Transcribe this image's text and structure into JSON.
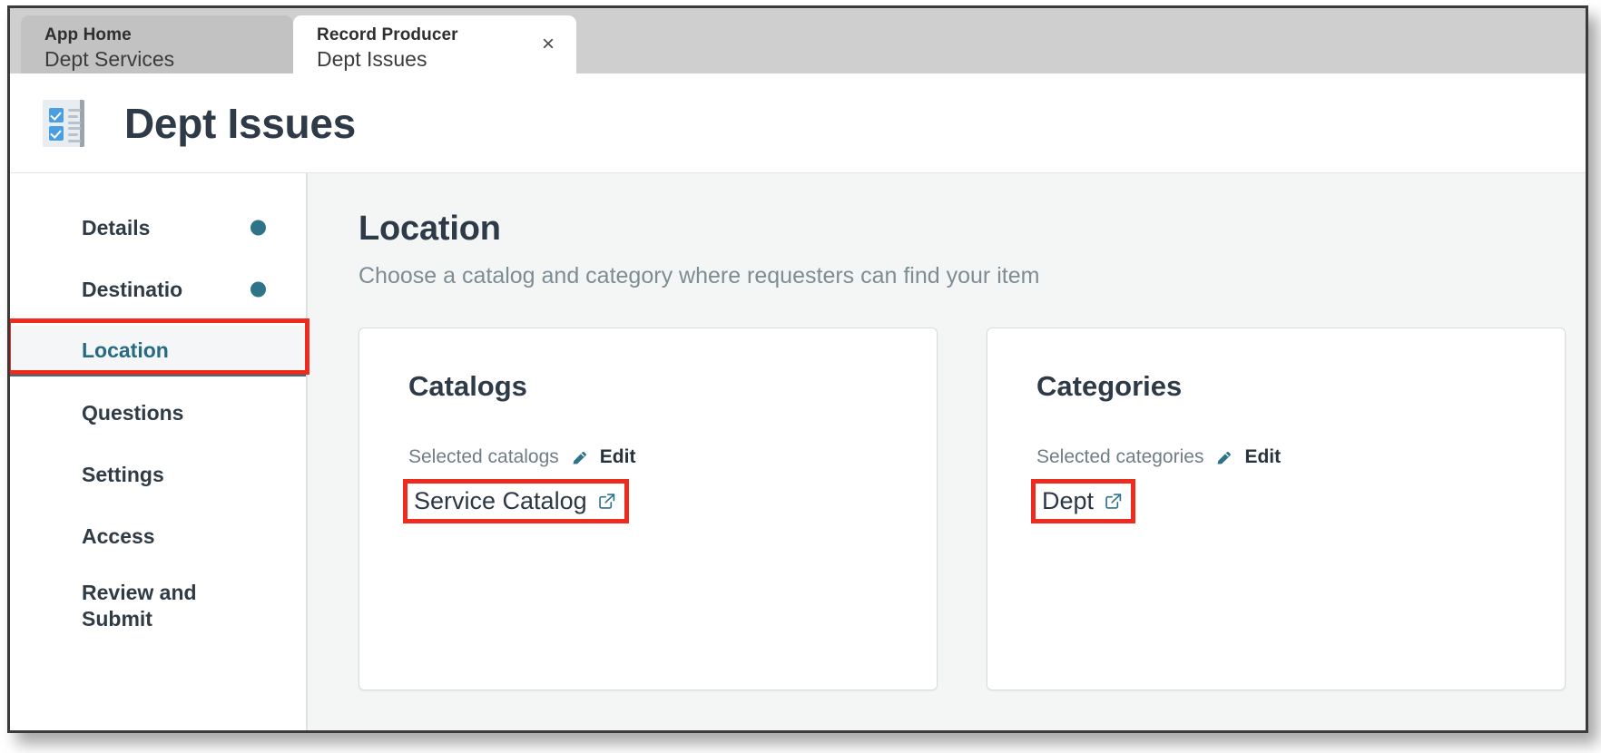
{
  "window": {
    "tabs": [
      {
        "kicker": "App Home",
        "title": "Dept Services",
        "active": false
      },
      {
        "kicker": "Record Producer",
        "title": "Dept Issues",
        "active": true,
        "close_label": "×"
      }
    ]
  },
  "header": {
    "icon": "checklist-document-icon",
    "title": "Dept Issues"
  },
  "sidebar": {
    "items": [
      {
        "label": "Details",
        "dot": true,
        "active": false
      },
      {
        "label": "Destinatio",
        "dot": true,
        "active": false
      },
      {
        "label": "Location",
        "dot": false,
        "active": true
      },
      {
        "label": "Questions",
        "dot": false,
        "active": false
      },
      {
        "label": "Settings",
        "dot": false,
        "active": false
      },
      {
        "label": "Access",
        "dot": false,
        "active": false
      },
      {
        "label": "Review and\nSubmit",
        "dot": false,
        "active": false
      }
    ]
  },
  "main": {
    "title": "Location",
    "subtitle": "Choose a catalog and category where requesters can find your item",
    "cards": [
      {
        "title": "Catalogs",
        "selected_label": "Selected catalogs",
        "edit_label": "Edit",
        "edit_icon": "pencil-icon",
        "value": "Service Catalog",
        "value_icon": "external-link-icon"
      },
      {
        "title": "Categories",
        "selected_label": "Selected categories",
        "edit_label": "Edit",
        "edit_icon": "pencil-icon",
        "value": "Dept",
        "value_icon": "external-link-icon"
      }
    ]
  },
  "colors": {
    "accent_teal": "#2f7389",
    "annotation_red": "#ef2b1e",
    "title_navy": "#2e3a47",
    "muted_gray": "#7e8c93",
    "icon_blue": "#4a9fe0"
  }
}
